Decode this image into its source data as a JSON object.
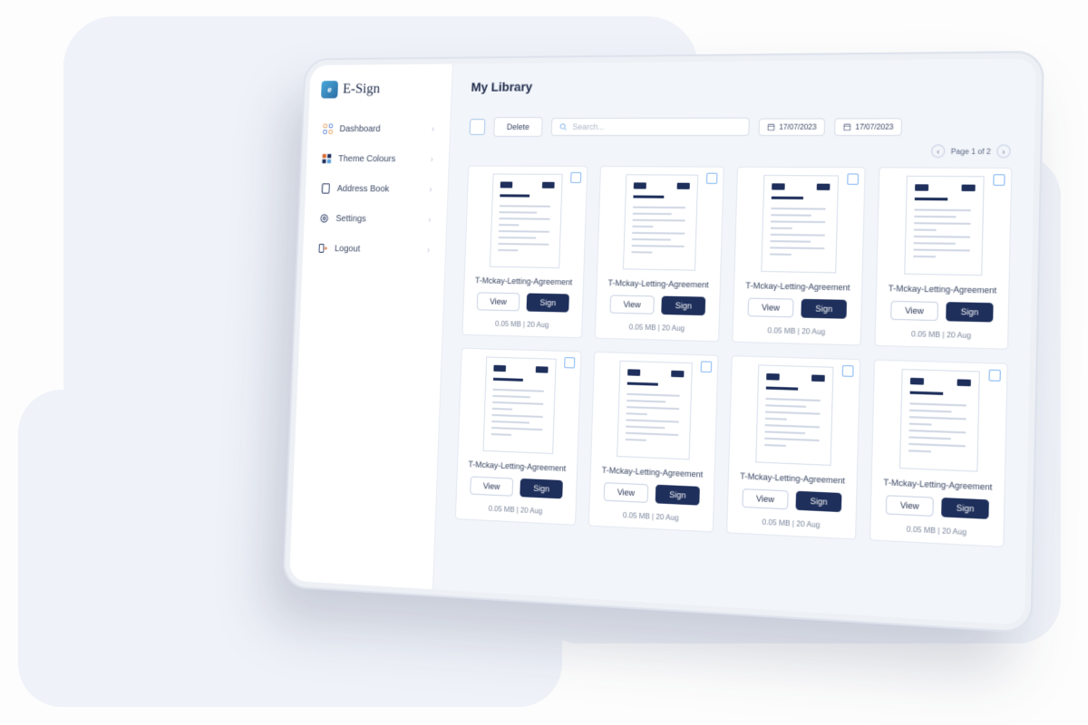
{
  "brand": {
    "name": "E-Sign"
  },
  "sidebar": {
    "items": [
      {
        "label": "Dashboard",
        "icon": "dashboard-icon"
      },
      {
        "label": "Theme Colours",
        "icon": "palette-icon"
      },
      {
        "label": "Address Book",
        "icon": "book-icon"
      },
      {
        "label": "Settings",
        "icon": "gear-icon"
      },
      {
        "label": "Logout",
        "icon": "logout-icon"
      }
    ]
  },
  "header": {
    "title": "My Library"
  },
  "toolbar": {
    "delete_label": "Delete",
    "search_placeholder": "Search...",
    "date_from": "17/07/2023",
    "date_to": "17/07/2023"
  },
  "pager": {
    "label": "Page 1 of 2"
  },
  "buttons": {
    "view": "View",
    "sign": "Sign"
  },
  "documents": [
    {
      "name": "T-Mckay-Letting-Agreement",
      "meta": "0.05 MB | 20 Aug"
    },
    {
      "name": "T-Mckay-Letting-Agreement",
      "meta": "0.05 MB | 20 Aug"
    },
    {
      "name": "T-Mckay-Letting-Agreement",
      "meta": "0.05 MB | 20 Aug"
    },
    {
      "name": "T-Mckay-Letting-Agreement",
      "meta": "0.05 MB | 20 Aug"
    },
    {
      "name": "T-Mckay-Letting-Agreement",
      "meta": "0.05 MB | 20 Aug"
    },
    {
      "name": "T-Mckay-Letting-Agreement",
      "meta": "0.05 MB | 20 Aug"
    },
    {
      "name": "T-Mckay-Letting-Agreement",
      "meta": "0.05 MB | 20 Aug"
    },
    {
      "name": "T-Mckay-Letting-Agreement",
      "meta": "0.05 MB | 20 Aug"
    }
  ],
  "colors": {
    "accent": "#1e2f5b",
    "surface": "#f2f5fa"
  }
}
